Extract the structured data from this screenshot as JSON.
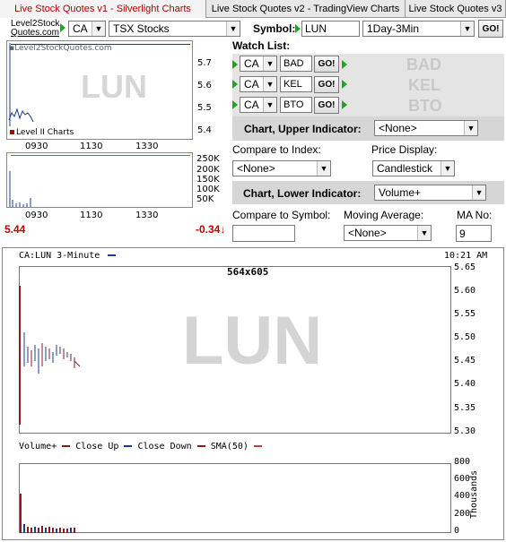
{
  "tabs": [
    {
      "label": "Live Stock Quotes v1 - Silverlight Charts",
      "active": true
    },
    {
      "label": "Live Stock Quotes v2 - TradingView Charts",
      "active": false
    },
    {
      "label": "Live Stock Quotes v3",
      "active": false
    }
  ],
  "logo": {
    "line1": "Level2Stock",
    "line2": "Quotes.com"
  },
  "controls": {
    "country": "CA",
    "exchange": "TSX Stocks",
    "symbol_label": "Symbol:",
    "symbol_value": "LUN",
    "period": "1Day-3Min",
    "go_label": "GO!"
  },
  "watchlist": {
    "title": "Watch List:",
    "items": [
      {
        "country": "CA",
        "symbol": "BAD",
        "go": "GO!",
        "display": "BAD"
      },
      {
        "country": "CA",
        "symbol": "KEL",
        "go": "GO!",
        "display": "KEL"
      },
      {
        "country": "CA",
        "symbol": "BTO",
        "go": "GO!",
        "display": "BTO"
      }
    ]
  },
  "options": {
    "upper_indicator_label": "Chart, Upper Indicator:",
    "upper_indicator_value": "<None>",
    "compare_index_label": "Compare to Index:",
    "compare_index_value": "<None>",
    "price_display_label": "Price Display:",
    "price_display_value": "Candlestick",
    "lower_indicator_label": "Chart, Lower Indicator:",
    "lower_indicator_value": "Volume+",
    "compare_symbol_label": "Compare to Symbol:",
    "compare_symbol_value": "",
    "moving_average_label": "Moving Average:",
    "moving_average_value": "<None>",
    "ma_no_label": "MA No:",
    "ma_no_value": "9"
  },
  "mini_chart": {
    "watermark_site": "▪Level2StockQuotes.com",
    "watermark_symbol": "LUN",
    "legend": "Level II Charts",
    "price_ticks": [
      "5.7",
      "5.6",
      "5.5",
      "5.4"
    ],
    "time_ticks": [
      "0930",
      "1130",
      "1330"
    ],
    "volume_ticks": [
      "250K",
      "200K",
      "150K",
      "100K",
      "50K"
    ],
    "time_ticks_vol": [
      "0930",
      "1130",
      "1330"
    ]
  },
  "quote": {
    "last": "5.44",
    "change": "-0.34",
    "change_arrow": "↓"
  },
  "main_chart": {
    "title": "CA:LUN 3-Minute",
    "time": "10:21 AM",
    "size_label": "564x605",
    "watermark": "LUN",
    "price_ticks": [
      "5.65",
      "5.60",
      "5.55",
      "5.50",
      "5.45",
      "5.40",
      "5.35",
      "5.30"
    ],
    "lower_legend": {
      "item1": "Volume+",
      "item2": "Close Up",
      "item3": "Close Down",
      "item4": "SMA(50)"
    },
    "volume_ticks": [
      "800",
      "600",
      "400",
      "200",
      "0"
    ],
    "volume_unit": "Thousands"
  },
  "colors": {
    "accent_red": "#b00000",
    "gray_panel": "#d6d6d6",
    "up_blue": "#1b3b8f",
    "down_red": "#8b1a1a"
  }
}
